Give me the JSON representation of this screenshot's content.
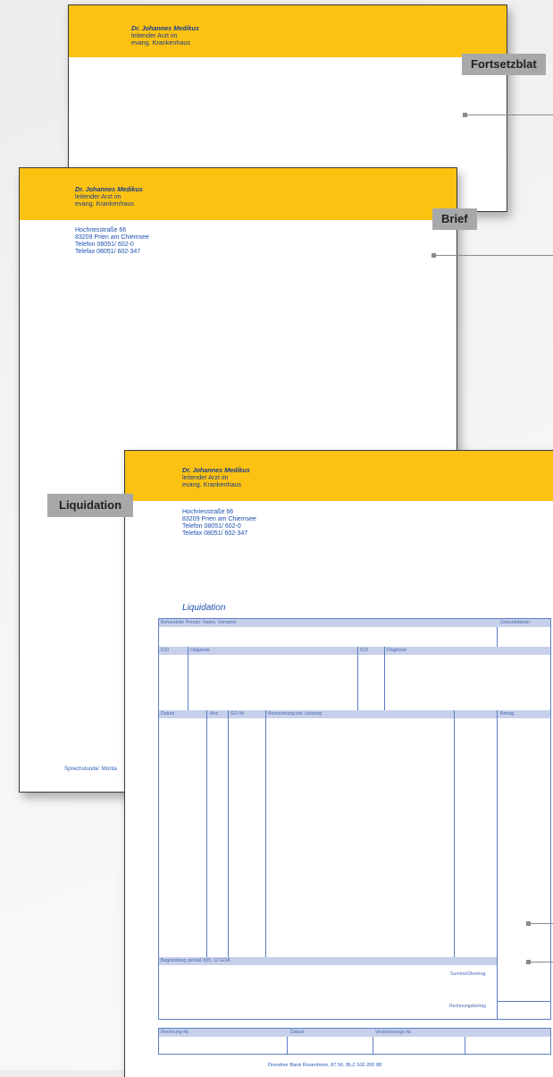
{
  "letterhead": {
    "name": "Dr. Johannes Medikus",
    "line2": "leitender Arzt im",
    "line3": "evang. Krankenhaus"
  },
  "address": {
    "street": "Hochriesstraße 66",
    "city": "83209 Prien am Chiemsee",
    "phone": "Telefon 08051/ 602-0",
    "fax": "Telefax 08051/ 602-347"
  },
  "labels": {
    "fortsetzblatt": "Fortsetzblat",
    "brief": "Brief",
    "liquidation": "Liquidation"
  },
  "brief_footer": "Sprechstunde: Monta",
  "form": {
    "title": "Liquidation",
    "person_label": "Behandelte Person: Name, Vorname",
    "birth_label": "Geburtsdatum",
    "icd_label": "ICD",
    "diagnose_label": "Diagnose",
    "icd2_label": "ICD",
    "diagnose2_label": "Diagnose",
    "col_datum": "Datum",
    "col_anz": "Anz.",
    "col_go": "GO-Nr.",
    "col_bez": "Bezeichnung der Leistung",
    "col_betrag": "Betrag",
    "begruendung": "Begründung gemäß §§5, 12 GOÄ",
    "summe": "Summe/Übertrag",
    "rechnungsbetrag": "Rechnungsbetrag",
    "rechnung_nr": "Rechnung-Nr.",
    "datum2": "Datum",
    "versicherung": "Versicherungs-Nr.",
    "bank": "Dresdner Bank Rosenheim, 87 56, BLZ 100 200 88"
  }
}
